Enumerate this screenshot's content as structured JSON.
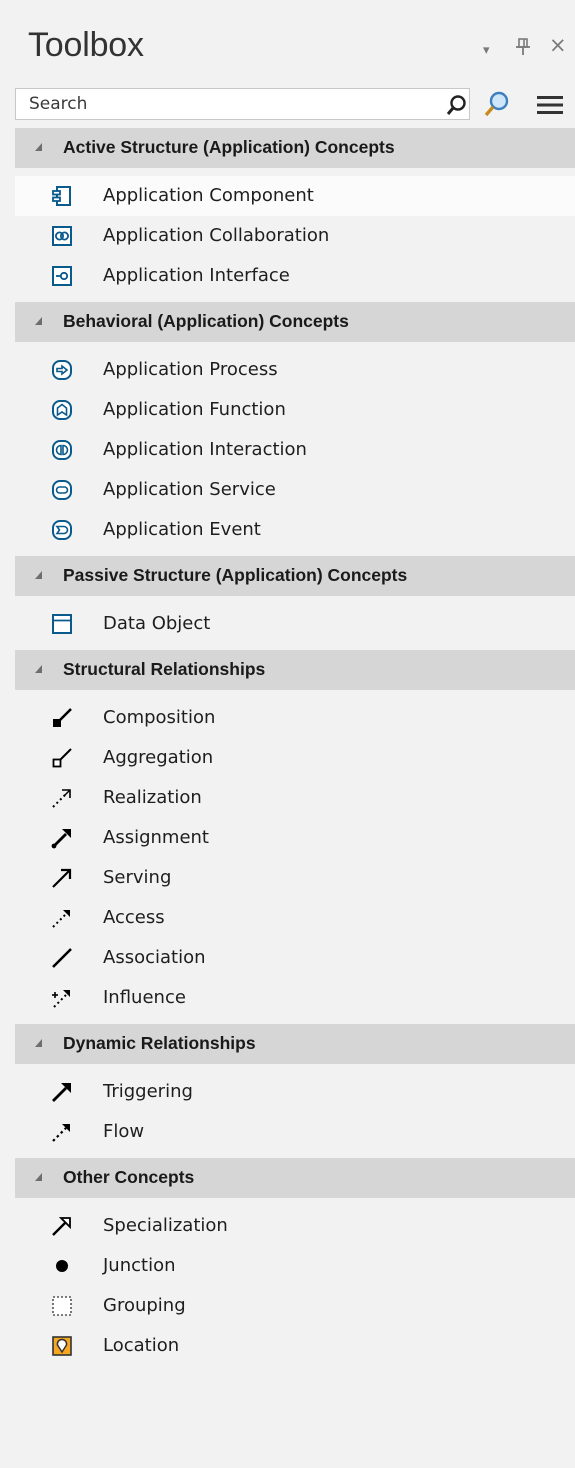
{
  "panel": {
    "title": "Toolbox",
    "controls": {
      "dropdown": "▾",
      "pin": "ᵽ",
      "close": "×"
    }
  },
  "search": {
    "placeholder": "Search",
    "value": ""
  },
  "sections": [
    {
      "title": "Active Structure (Application) Concepts",
      "items": [
        {
          "label": "Application Component",
          "icon": "application-component-icon",
          "selected": true
        },
        {
          "label": "Application Collaboration",
          "icon": "application-collaboration-icon"
        },
        {
          "label": "Application Interface",
          "icon": "application-interface-icon"
        }
      ]
    },
    {
      "title": "Behavioral (Application) Concepts",
      "items": [
        {
          "label": "Application Process",
          "icon": "application-process-icon"
        },
        {
          "label": "Application Function",
          "icon": "application-function-icon"
        },
        {
          "label": "Application Interaction",
          "icon": "application-interaction-icon"
        },
        {
          "label": "Application Service",
          "icon": "application-service-icon"
        },
        {
          "label": "Application Event",
          "icon": "application-event-icon"
        }
      ]
    },
    {
      "title": "Passive Structure (Application) Concepts",
      "items": [
        {
          "label": "Data Object",
          "icon": "data-object-icon"
        }
      ]
    },
    {
      "title": "Structural Relationships",
      "items": [
        {
          "label": "Composition",
          "icon": "composition-icon"
        },
        {
          "label": "Aggregation",
          "icon": "aggregation-icon"
        },
        {
          "label": "Realization",
          "icon": "realization-icon"
        },
        {
          "label": "Assignment",
          "icon": "assignment-icon"
        },
        {
          "label": "Serving",
          "icon": "serving-icon"
        },
        {
          "label": "Access",
          "icon": "access-icon"
        },
        {
          "label": "Association",
          "icon": "association-icon"
        },
        {
          "label": "Influence",
          "icon": "influence-icon"
        }
      ]
    },
    {
      "title": "Dynamic Relationships",
      "items": [
        {
          "label": "Triggering",
          "icon": "triggering-icon"
        },
        {
          "label": "Flow",
          "icon": "flow-icon"
        }
      ]
    },
    {
      "title": "Other Concepts",
      "items": [
        {
          "label": "Specialization",
          "icon": "specialization-icon"
        },
        {
          "label": "Junction",
          "icon": "junction-icon"
        },
        {
          "label": "Grouping",
          "icon": "grouping-icon"
        },
        {
          "label": "Location",
          "icon": "location-icon"
        }
      ]
    }
  ],
  "colors": {
    "panel_bg": "#f2f2f2",
    "section_bg": "#d6d6d6",
    "selected_bg": "#fbfbfb",
    "icon_blue": "#0a5a8c",
    "location_orange": "#f5a623"
  }
}
